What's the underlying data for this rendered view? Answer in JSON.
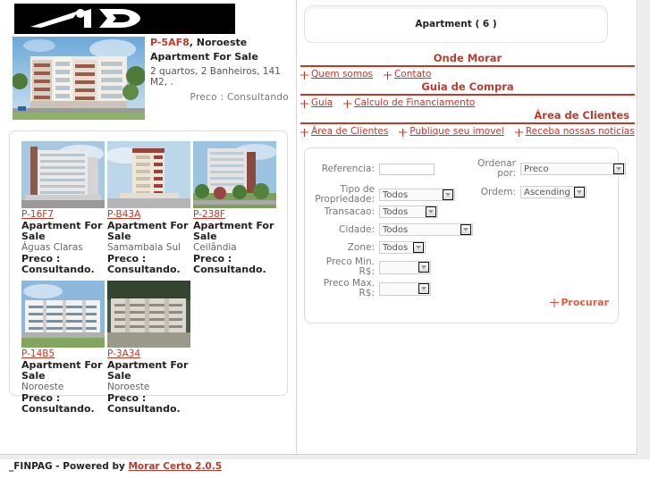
{
  "site": {
    "logo_alt": "1D logo"
  },
  "hero": {
    "ref": "P-5AF8",
    "location": ", Noroeste",
    "title": "Apartment For Sale",
    "details": "2 quartos, 2 Banheiros, 141 M2, .",
    "price": "Preco : Consultando"
  },
  "featured": [
    {
      "ref": "P-16F7",
      "title": "Apartment For Sale",
      "city": "Águas Claras",
      "price": "Preco : Consultando."
    },
    {
      "ref": "P-B43A",
      "title": "Apartment For Sale",
      "city": "Samambaia Sul",
      "price": "Preco : Consultando."
    },
    {
      "ref": "P-238F",
      "title": "Apartment For Sale",
      "city": "Ceilândia",
      "price": "Preco : Consultando."
    },
    {
      "ref": "P-14B5",
      "title": "Apartment For Sale",
      "city": "Noroeste",
      "price": "Preco : Consultando."
    },
    {
      "ref": "P-3A34",
      "title": "Apartment For Sale",
      "city": "Noroeste",
      "price": "Preco : Consultando."
    }
  ],
  "category_header": "Apartment ( 6 )",
  "nav_sections": [
    {
      "title": "Onde Morar",
      "align": "center",
      "links": [
        "Quem somos",
        "Contato"
      ]
    },
    {
      "title": "Guia de Compra",
      "align": "center",
      "links": [
        "Guia",
        "Calculo de Financiamento"
      ]
    },
    {
      "title": "Área de Clientes",
      "align": "right",
      "links": [
        "Área de Clientes",
        "Publique seu imovel",
        "Receba nossas noticias"
      ]
    }
  ],
  "search": {
    "referencia_label": "Referencia:",
    "referencia_value": "",
    "tipo_label": "Tipo de Propriedade:",
    "tipo_value": "Todos",
    "transacao_label": "Transacao:",
    "transacao_value": "Todos",
    "cidade_label": "Cidade:",
    "cidade_value": "Todos",
    "zone_label": "Zone:",
    "zone_value": "Todos",
    "preco_min_label": "Preco Min. R$:",
    "preco_min_value": "",
    "preco_max_label": "Preco Max. R$:",
    "preco_max_value": "",
    "ordenar_label": "Ordenar por:",
    "ordenar_value": "Preco",
    "ordem_label": "Ordem:",
    "ordem_value": "Ascending",
    "submit_label": "Procurar"
  },
  "footer": {
    "text": "_FINPAG - Powered by ",
    "link": "Morar Certo 2.0.5"
  },
  "colors": {
    "accent": "#c0392b",
    "submit": "#e25c3d",
    "text": "#222222",
    "muted": "#777777"
  }
}
